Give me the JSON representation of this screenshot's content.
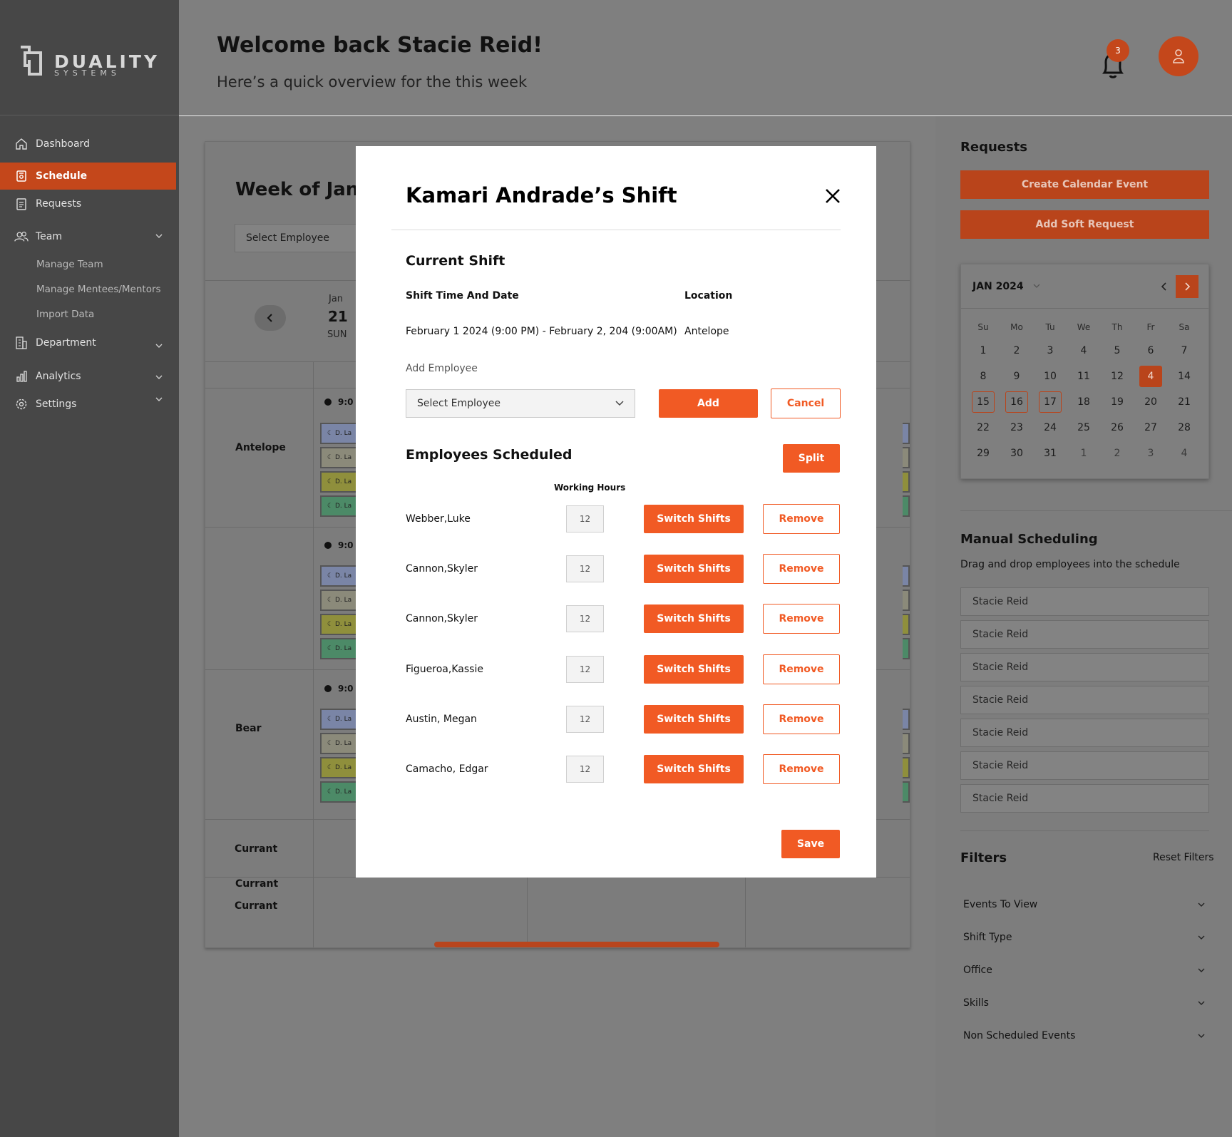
{
  "brand": {
    "name": "DUALITY",
    "sub": "SYSTEMS"
  },
  "nav": {
    "items": [
      {
        "label": "Dashboard",
        "icon": "home-icon"
      },
      {
        "label": "Schedule",
        "icon": "calendar-icon",
        "active": true
      },
      {
        "label": "Requests",
        "icon": "clipboard-icon"
      },
      {
        "label": "Team",
        "icon": "users-icon"
      },
      {
        "label": "Department",
        "icon": "building-icon"
      },
      {
        "label": "Analytics",
        "icon": "bar-chart-icon"
      },
      {
        "label": "Settings",
        "icon": "gear-icon"
      }
    ],
    "team_sub": [
      "Manage Team",
      "Manage Mentees/Mentors",
      "Import Data"
    ]
  },
  "header": {
    "welcome": "Welcome back Stacie Reid!",
    "overview": "Here’s a quick overview for the this week",
    "notification_count": "3"
  },
  "schedule": {
    "title": "Week of Janu",
    "select_placeholder": "Select Employee",
    "day": {
      "month": "Jan",
      "num": "21",
      "dow": "SUN"
    },
    "locations": [
      "Antelope",
      "Bear",
      "Currant",
      "Currant",
      "Currant"
    ],
    "shift_time": "9:0",
    "chip_text": "D. La"
  },
  "right_panel": {
    "requests_title": "Requests",
    "create_event": "Create Calendar Event",
    "add_soft_request": "Add Soft Request",
    "calendar": {
      "month": "JAN 2024",
      "dow": [
        "Su",
        "Mo",
        "Tu",
        "We",
        "Th",
        "Fr",
        "Sa"
      ],
      "weeks": [
        [
          "1",
          "2",
          "3",
          "4",
          "5",
          "6",
          "7"
        ],
        [
          "8",
          "9",
          "10",
          "11",
          "12",
          "4",
          "14"
        ],
        [
          "15",
          "16",
          "17",
          "18",
          "19",
          "20",
          "21"
        ],
        [
          "22",
          "23",
          "24",
          "25",
          "26",
          "27",
          "28"
        ],
        [
          "29",
          "30",
          "31",
          "1",
          "2",
          "3",
          "4"
        ]
      ]
    },
    "manual_title": "Manual Scheduling",
    "manual_sub": "Drag and drop employees into the schedule",
    "manual_employees": [
      "Stacie Reid",
      "Stacie Reid",
      "Stacie Reid",
      "Stacie Reid",
      "Stacie Reid",
      "Stacie Reid",
      "Stacie Reid"
    ],
    "filters_title": "Filters",
    "reset_filters": "Reset Filters",
    "filters": [
      "Events To View",
      "Shift Type",
      "Office",
      "Skills",
      "Non Scheduled Events"
    ]
  },
  "modal": {
    "title": "Kamari Andrade’s Shift",
    "current_shift": "Current Shift",
    "shift_time_label": "Shift Time And Date",
    "location_label": "Location",
    "shift_time_value": "February 1 2024 (9:00 PM) - February 2, 204 (9:00AM)",
    "location_value": "Antelope",
    "add_employee_label": "Add Employee",
    "select_placeholder": "Select Employee",
    "add": "Add",
    "cancel": "Cancel",
    "employees_title": "Employees Scheduled",
    "split": "Split",
    "working_hours": "Working Hours",
    "switch": "Switch Shifts",
    "remove": "Remove",
    "save": "Save",
    "employees": [
      {
        "name": "Webber,Luke",
        "hours": "12"
      },
      {
        "name": "Cannon,Skyler",
        "hours": "12"
      },
      {
        "name": "Cannon,Skyler",
        "hours": "12"
      },
      {
        "name": "Figueroa,Kassie",
        "hours": "12"
      },
      {
        "name": "Austin, Megan",
        "hours": "12"
      },
      {
        "name": "Camacho, Edgar",
        "hours": "12"
      }
    ]
  },
  "colors": {
    "accent": "#f15a24",
    "accent_dim": "#b9441b",
    "sidebar": "#474747",
    "chip_blue": "#7a85a6",
    "chip_tan": "#8b8a7a",
    "chip_yellow": "#8f8f3c",
    "chip_green": "#4c8a67"
  }
}
